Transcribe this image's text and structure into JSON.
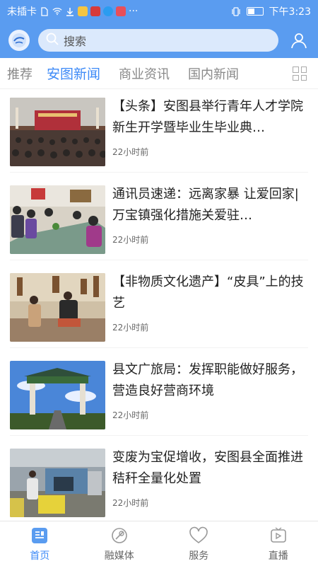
{
  "status_bar": {
    "carrier": "未插卡",
    "more": "···",
    "time": "下午3:23",
    "colors": {
      "bg": "#5a9cf0"
    }
  },
  "header": {
    "search": {
      "placeholder": "搜索"
    }
  },
  "tabs": [
    {
      "label": "推荐"
    },
    {
      "label": "安图新闻",
      "active": true
    },
    {
      "label": "商业资讯"
    },
    {
      "label": "国内新闻"
    }
  ],
  "news": [
    {
      "title": "【头条】安图县举行青年人才学院新生开学暨毕业生毕业典…",
      "time": "22小时前"
    },
    {
      "title": "通讯员速递：远离家暴 让爱回家|  万宝镇强化措施关爱驻…",
      "time": "22小时前"
    },
    {
      "title": "【非物质文化遗产】“皮具”上的技艺",
      "time": "22小时前"
    },
    {
      "title": "县文广旅局：发挥职能做好服务，营造良好营商环境",
      "time": "22小时前"
    },
    {
      "title": "变废为宝促增收，安图县全面推进秸秆全量化处置",
      "time": "22小时前"
    }
  ],
  "bottom_nav": [
    {
      "label": "首页",
      "icon": "home-news-icon",
      "active": true
    },
    {
      "label": "融媒体",
      "icon": "media-icon"
    },
    {
      "label": "服务",
      "icon": "heart-icon"
    },
    {
      "label": "直播",
      "icon": "live-icon"
    }
  ],
  "colors": {
    "accent": "#3d8af7",
    "header": "#5a9cf0"
  }
}
